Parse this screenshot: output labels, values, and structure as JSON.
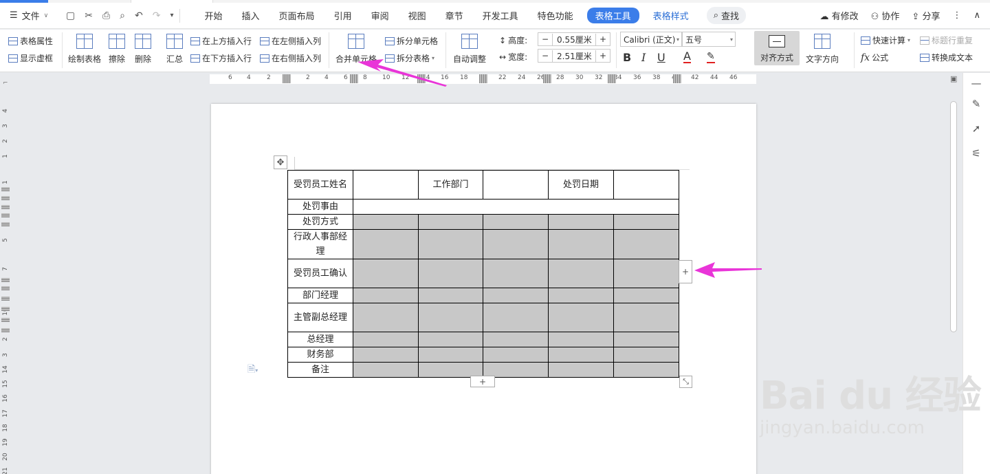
{
  "menubar": {
    "file_label": "文件",
    "tabs": [
      {
        "label": "开始"
      },
      {
        "label": "插入"
      },
      {
        "label": "页面布局"
      },
      {
        "label": "引用"
      },
      {
        "label": "审阅"
      },
      {
        "label": "视图"
      },
      {
        "label": "章节"
      },
      {
        "label": "开发工具"
      },
      {
        "label": "特色功能"
      },
      {
        "label": "表格工具"
      },
      {
        "label": "表格样式"
      }
    ],
    "search_label": "查找",
    "right": {
      "modified": "有修改",
      "collab": "协作",
      "share": "分享"
    }
  },
  "ribbon": {
    "table_props": "表格属性",
    "show_gridlines": "显示虚框",
    "draw_table": "绘制表格",
    "erase": "擦除",
    "delete": "删除",
    "summary": "汇总",
    "insert_row_above": "在上方插入行",
    "insert_row_below": "在下方插入行",
    "insert_col_left": "在左侧插入列",
    "insert_col_right": "在右侧插入列",
    "merge_cells": "合并单元格",
    "split_cells": "拆分单元格",
    "split_table": "拆分表格",
    "auto_fit": "自动调整",
    "height_label": "高度:",
    "height_value": "0.55厘米",
    "width_label": "宽度:",
    "width_value": "2.51厘米",
    "font_name": "Calibri (正文)",
    "font_size": "五号",
    "align": "对齐方式",
    "text_direction": "文字方向",
    "quick_calc": "快速计算",
    "repeat_header": "标题行重复",
    "formula": "公式",
    "convert_to_text": "转换成文本",
    "accent_color": "#3b7de9"
  },
  "ruler": {
    "h_ticks": [
      "6",
      "4",
      "2",
      "2",
      "4",
      "6",
      "8",
      "10",
      "12",
      "14",
      "16",
      "18",
      "20",
      "22",
      "24",
      "26",
      "28",
      "30",
      "32",
      "34",
      "36",
      "38",
      "40",
      "42",
      "44",
      "46"
    ],
    "v_ticks": [
      "4",
      "3",
      "2",
      "1",
      "1",
      "5",
      "7",
      "10",
      "2",
      "3",
      "14",
      "15",
      "16",
      "17",
      "18",
      "19",
      "20",
      "21"
    ]
  },
  "table": {
    "rows": [
      [
        "受罚员工姓名",
        "",
        "工作部门",
        "",
        "处罚日期",
        ""
      ],
      [
        "处罚事由",
        ""
      ],
      [
        "处罚方式",
        "",
        "",
        "",
        "",
        ""
      ],
      [
        "行政人事部经理",
        "",
        "",
        "",
        "",
        ""
      ],
      [
        "受罚员工确认",
        "",
        "",
        "",
        "",
        ""
      ],
      [
        "部门经理",
        "",
        "",
        "",
        "",
        ""
      ],
      [
        "主管副总经理",
        "",
        "",
        "",
        "",
        ""
      ],
      [
        "总经理",
        "",
        "",
        "",
        "",
        ""
      ],
      [
        "财务部",
        "",
        "",
        "",
        "",
        ""
      ],
      [
        "备注",
        "",
        "",
        "",
        "",
        ""
      ]
    ]
  },
  "handles": {
    "add": "+"
  },
  "watermark": {
    "brand": "Bai du 经验",
    "url": "jingyan.baidu.com"
  },
  "annotation_color": "#e935d8"
}
